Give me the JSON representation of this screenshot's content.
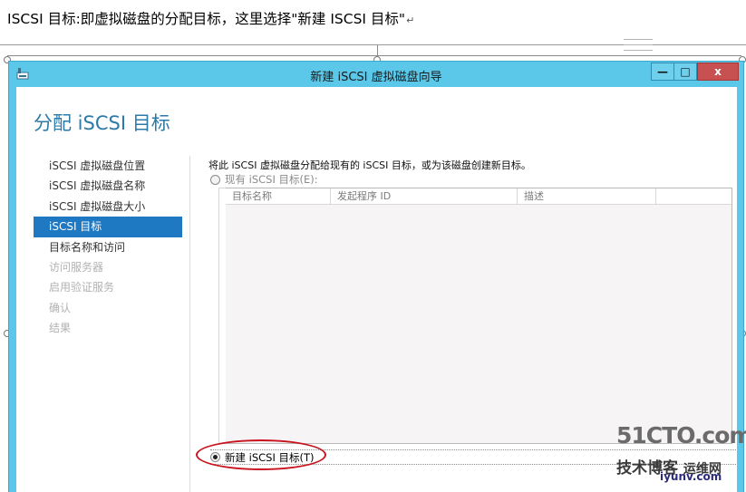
{
  "doc": {
    "caption": "ISCSI 目标:即虚拟磁盘的分配目标，这里选择\"新建 ISCSI 目标\"",
    "paragraph_mark": "↵"
  },
  "window": {
    "title": "新建 iSCSI 虚拟磁盘向导",
    "min_label": "—",
    "max_label": "□",
    "close_label": "x"
  },
  "page": {
    "heading": "分配 iSCSI 目标"
  },
  "nav": {
    "items": [
      {
        "label": "iSCSI 虚拟磁盘位置",
        "state": "enabled"
      },
      {
        "label": "iSCSI 虚拟磁盘名称",
        "state": "enabled"
      },
      {
        "label": "iSCSI 虚拟磁盘大小",
        "state": "enabled"
      },
      {
        "label": "iSCSI 目标",
        "state": "active"
      },
      {
        "label": "目标名称和访问",
        "state": "enabled"
      },
      {
        "label": "访问服务器",
        "state": "disabled"
      },
      {
        "label": "启用验证服务",
        "state": "disabled"
      },
      {
        "label": "确认",
        "state": "disabled"
      },
      {
        "label": "结果",
        "state": "disabled"
      }
    ]
  },
  "content": {
    "description": "将此 iSCSI 虚拟磁盘分配给现有的 iSCSI 目标，或为该磁盘创建新目标。",
    "existing_option": {
      "label": "现有 iSCSI 目标(E):",
      "checked": false
    },
    "table": {
      "columns": [
        "目标名称",
        "发起程序 ID",
        "描述",
        ""
      ],
      "rows": []
    },
    "new_option": {
      "label": "新建 iSCSI 目标(T)",
      "checked": true
    }
  },
  "watermark": {
    "site": "51CTO.com",
    "tagline": "技术博客",
    "extra": "运维网",
    "domain": "iyunv.com"
  },
  "colors": {
    "window_frame": "#5bc8ea",
    "heading": "#2b7aa8",
    "nav_active_bg": "#1e78c2",
    "close_button": "#c75050",
    "annotation": "#c8141e"
  }
}
